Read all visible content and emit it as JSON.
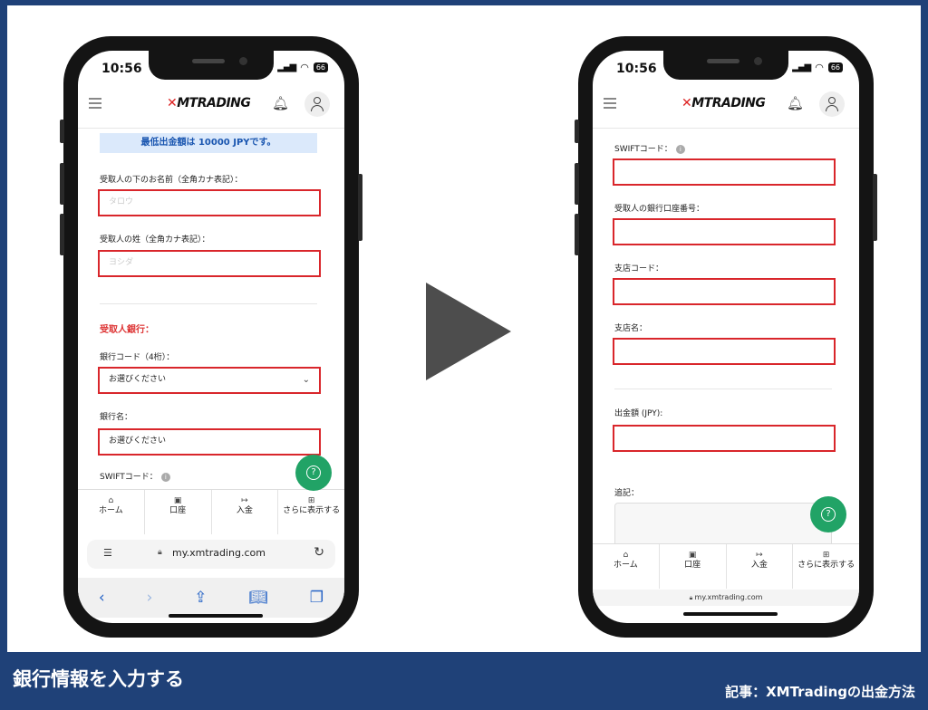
{
  "footer": {
    "title": "銀行情報を入力する",
    "article": "記事：XMTradingの出金方法"
  },
  "status": {
    "time": "10:56",
    "battery": "66"
  },
  "app": {
    "logo_mark": "✕",
    "logo_text": "MTRADING"
  },
  "left_phone": {
    "notice": "最低出金額は 10000 JPYです。",
    "given_name_label": "受取人の下のお名前（全角カナ表記）：",
    "given_name_placeholder": "タロウ",
    "family_name_label": "受取人の姓（全角カナ表記）：",
    "family_name_placeholder": "ヨシダ",
    "bank_section_title": "受取人銀行：",
    "bank_code_label": "銀行コード（4桁）：",
    "bank_code_value": "お選びください",
    "bank_name_label": "銀行名：",
    "bank_name_value": "お選びください",
    "swift_label_partial": "SWIFTコード：",
    "url": "my.xmtrading.com"
  },
  "right_phone": {
    "swift_label": "SWIFTコード：",
    "account_number_label": "受取人の銀行口座番号：",
    "branch_code_label": "支店コード：",
    "branch_name_label": "支店名：",
    "amount_label": "出金額 (JPY):",
    "memo_label": "追記：",
    "url": "my.xmtrading.com"
  },
  "nav": {
    "home": "ホーム",
    "account": "口座",
    "deposit": "入金",
    "more": "さらに表示する"
  }
}
